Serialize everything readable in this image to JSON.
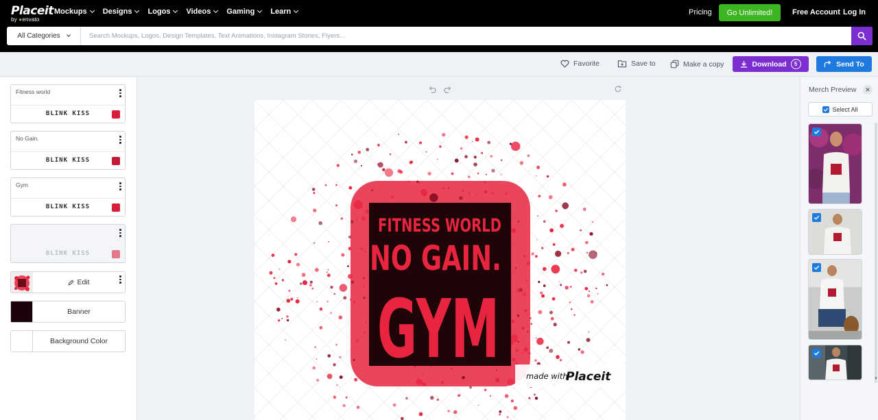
{
  "brand": {
    "name": "Placeit",
    "by": "by",
    "vendor": "envato"
  },
  "nav": [
    {
      "label": "Mockups"
    },
    {
      "label": "Designs"
    },
    {
      "label": "Logos"
    },
    {
      "label": "Videos"
    },
    {
      "label": "Gaming"
    },
    {
      "label": "Learn"
    }
  ],
  "header": {
    "pricing": "Pricing",
    "go_unlimited": "Go Unlimited!",
    "free_account": "Free Account",
    "login": "Log In"
  },
  "search": {
    "category": "All Categories",
    "placeholder": "Search Mockups, Logos, Design Templates, Text Animations, Instagram Stories, Flyers..."
  },
  "toolbar": {
    "favorite": "Favorite",
    "save_to": "Save to",
    "make_copy": "Make a copy",
    "download": "Download",
    "download_count": "5",
    "send_to": "Send To"
  },
  "layers": [
    {
      "text": "Fitness world",
      "font": "BLINK KISS",
      "color": "#d81e3a"
    },
    {
      "text": "No Gain.",
      "font": "BLINK KISS",
      "color": "#c41a35"
    },
    {
      "text": "Gym",
      "font": "BLINK KISS",
      "color": "#d81e3a"
    },
    {
      "text": "",
      "font": "BLINK KISS",
      "color": "#e27a8a"
    }
  ],
  "graphic": {
    "edit_label": "Edit"
  },
  "banner": {
    "label": "Banner",
    "color": "#1b0208"
  },
  "background": {
    "label": "Background Color",
    "color": "#ffffff"
  },
  "design": {
    "line1": "FITNESS WORLD",
    "line2": "NO GAIN.",
    "line3": "GYM",
    "watermark_made": "made with",
    "watermark_brand": "Placeit",
    "accent": "#e8243f",
    "panel": "#1d0508"
  },
  "merch": {
    "title": "Merch Preview",
    "select_all": "Select All"
  }
}
